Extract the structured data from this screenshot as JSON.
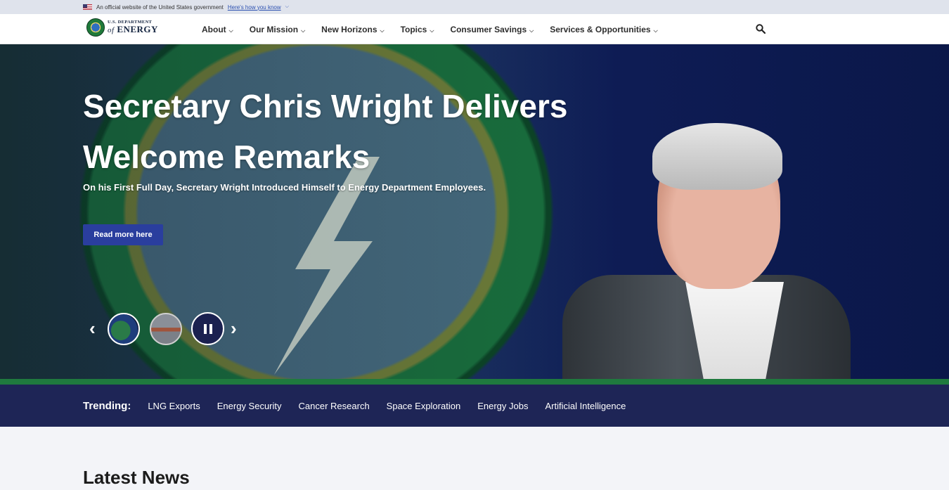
{
  "gov_banner": {
    "text": "An official website of the United States government",
    "link": "Here's how you know"
  },
  "logo": {
    "line1": "U.S. DEPARTMENT",
    "of": "of",
    "line2": "ENERGY"
  },
  "nav": {
    "items": [
      {
        "label": "About"
      },
      {
        "label": "Our Mission"
      },
      {
        "label": "New Horizons"
      },
      {
        "label": "Topics"
      },
      {
        "label": "Consumer Savings"
      },
      {
        "label": "Services & Opportunities"
      }
    ]
  },
  "hero": {
    "title": "Secretary Chris Wright Delivers Welcome Remarks",
    "subtitle": "On his First Full Day, Secretary Wright Introduced Himself to Energy Department Employees.",
    "button": "Read more here"
  },
  "trending": {
    "label": "Trending:",
    "links": [
      {
        "label": "LNG Exports"
      },
      {
        "label": "Energy Security"
      },
      {
        "label": "Cancer Research"
      },
      {
        "label": "Space Exploration"
      },
      {
        "label": "Energy Jobs"
      },
      {
        "label": "Artificial Intelligence"
      }
    ]
  },
  "latest_news": {
    "heading": "Latest News"
  },
  "colors": {
    "trending_bg": "#1e2556",
    "accent_green": "#1f7a3e",
    "button_blue": "#2a3e9e"
  }
}
